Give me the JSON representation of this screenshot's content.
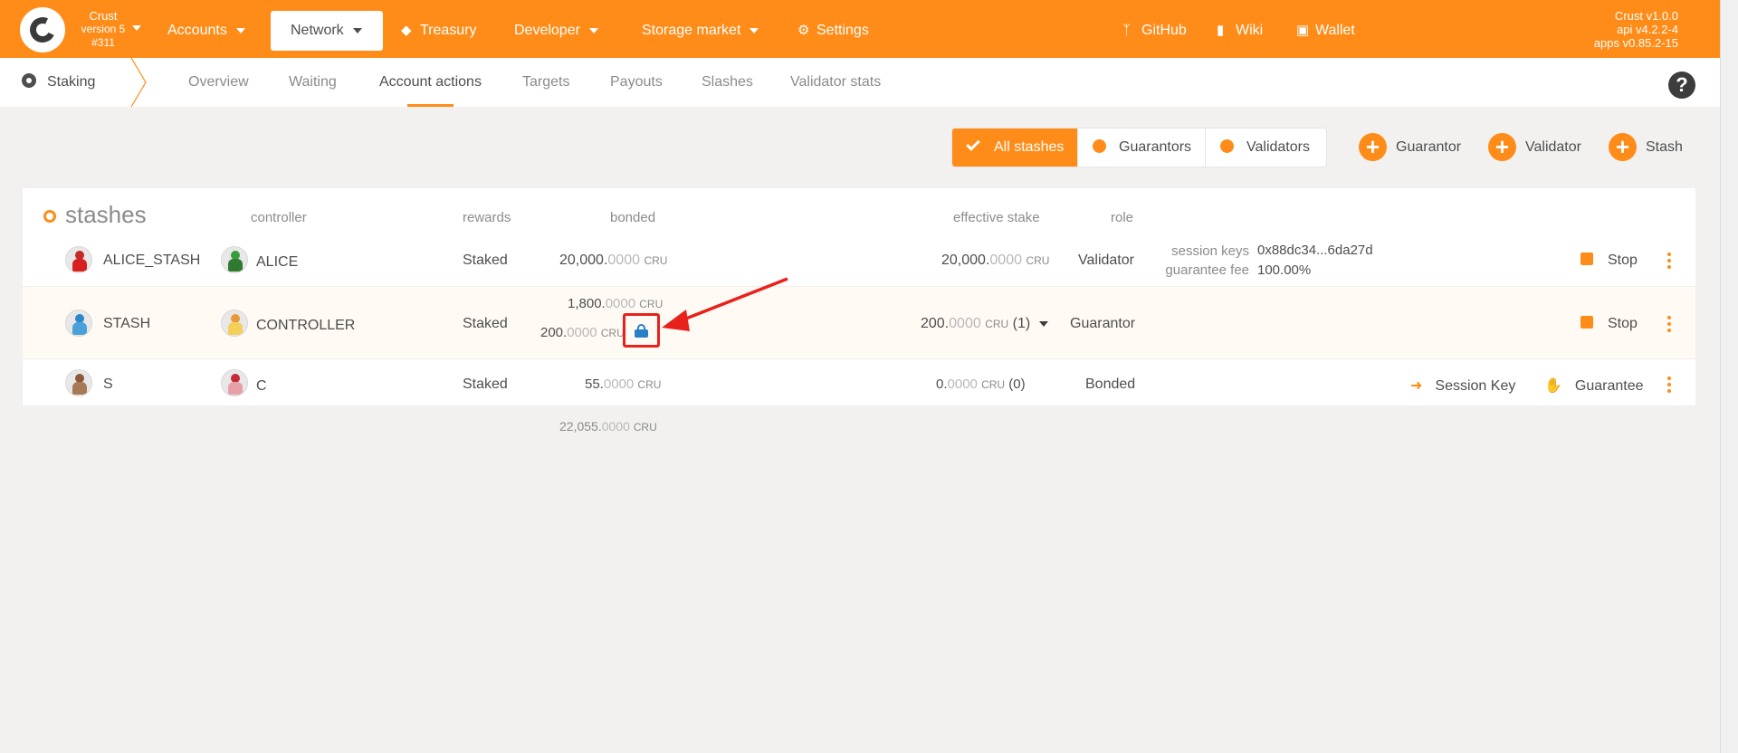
{
  "app": {
    "name": "Crust",
    "chain_version": "version 5",
    "block": "#311",
    "versions": [
      "Crust v1.0.0",
      "api v4.2.2-4",
      "apps v0.85.2-15"
    ]
  },
  "nav": {
    "items": [
      {
        "label": "Accounts",
        "icon": "",
        "dropdown": true
      },
      {
        "label": "Network",
        "icon": "",
        "dropdown": true,
        "active": true
      },
      {
        "label": "Treasury",
        "icon": "diamond-icon"
      },
      {
        "label": "Developer",
        "icon": "",
        "dropdown": true
      },
      {
        "label": "Storage market",
        "icon": "",
        "dropdown": true
      },
      {
        "label": "Settings",
        "icon": "gears-icon"
      }
    ],
    "right": [
      {
        "label": "GitHub",
        "icon": "code-branch-icon"
      },
      {
        "label": "Wiki",
        "icon": "book-icon"
      },
      {
        "label": "Wallet",
        "icon": "wallet-icon"
      }
    ]
  },
  "subnav": {
    "section": "Staking",
    "tabs": [
      "Overview",
      "Waiting",
      "Account actions",
      "Targets",
      "Payouts",
      "Slashes",
      "Validator stats"
    ],
    "active_tab": "Account actions"
  },
  "filters": {
    "options": [
      "All stashes",
      "Guarantors",
      "Validators"
    ],
    "selected": "All stashes"
  },
  "actions": [
    "Guarantor",
    "Validator",
    "Stash"
  ],
  "table": {
    "title": "stashes",
    "columns": {
      "controller": "controller",
      "rewards": "rewards",
      "bonded": "bonded",
      "effective_stake": "effective stake",
      "role": "role"
    },
    "unit": "CRU",
    "rows": [
      {
        "stash": "ALICE_STASH",
        "controller": "ALICE",
        "rewards": "Staked",
        "bonded_int": "20,000.",
        "bonded_dec": "0000",
        "eff_int": "20,000.",
        "eff_dec": "0000",
        "eff_suffix": "",
        "role": "Validator",
        "session_keys_label": "session keys",
        "session_keys": "0x88dc34...6da27d",
        "fee_label": "guarantee fee",
        "fee": "100.00%",
        "action": "Stop"
      },
      {
        "stash": "STASH",
        "controller": "CONTROLLER",
        "rewards": "Staked",
        "bonded_int": "1,800.",
        "bonded_dec": "0000",
        "locked_int": "200.",
        "locked_dec": "0000",
        "eff_int": "200.",
        "eff_dec": "0000",
        "eff_suffix": "(1)",
        "role": "Guarantor",
        "action": "Stop"
      },
      {
        "stash": "S",
        "controller": "C",
        "rewards": "Staked",
        "bonded_int": "55.",
        "bonded_dec": "0000",
        "eff_int": "0.",
        "eff_dec": "0000",
        "eff_suffix": "(0)",
        "role": "Bonded",
        "action_1": "Session Key",
        "action_2": "Guarantee"
      }
    ],
    "total_int": "22,055.",
    "total_dec": "0000"
  },
  "colors": {
    "accent": "#ff8c18",
    "highlight": "#e8211d",
    "lock": "#2a7fc9"
  }
}
